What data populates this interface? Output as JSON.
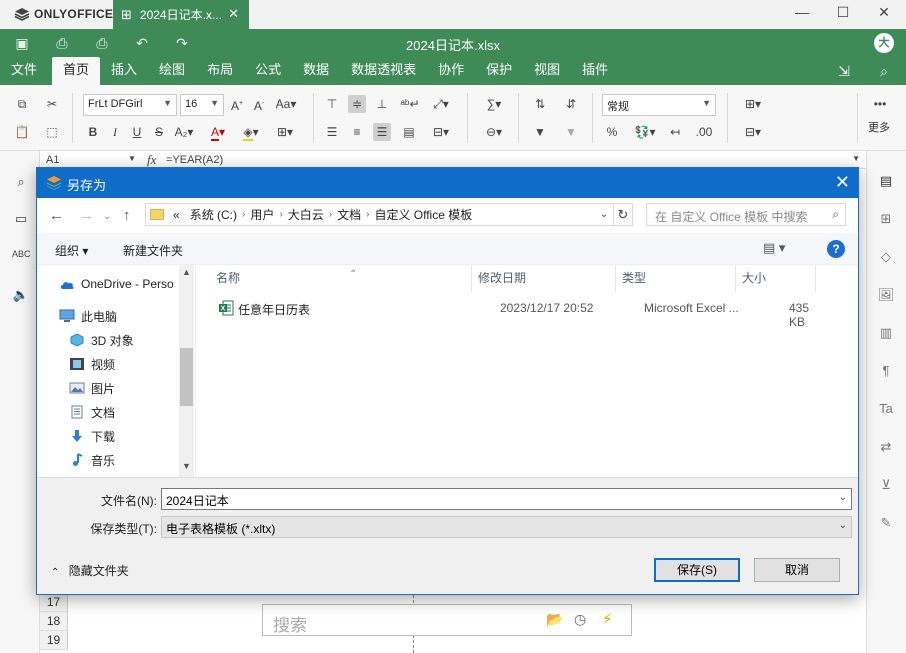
{
  "app": {
    "logo_text": "ONLYOFFICE",
    "tab_title": "2024日记本.x...",
    "file_title": "2024日记本.xlsx",
    "avatar_initial": "大",
    "accent_color": "#3f8b58"
  },
  "menu": {
    "tabs": [
      "文件",
      "首页",
      "插入",
      "绘图",
      "布局",
      "公式",
      "数据",
      "数据透视表",
      "协作",
      "保护",
      "视图",
      "插件"
    ],
    "active_tab": "首页"
  },
  "ribbon": {
    "font_name": "FrLt DFGirl",
    "font_size": "16",
    "number_format": "常规",
    "more_label": "更多"
  },
  "formula_bar": {
    "cell_ref": "A1",
    "fx_label": "fx",
    "formula": "=YEAR(A2)"
  },
  "sheet": {
    "row_headers": [
      "17",
      "18",
      "19"
    ],
    "search_placeholder": "搜索"
  },
  "dialog": {
    "title": "另存为",
    "accent_color": "#0f6cc9",
    "address": {
      "prefix": "«",
      "crumbs": [
        "系统 (C:)",
        "用户",
        "大白云",
        "文档",
        "自定义 Office 模板"
      ]
    },
    "search_placeholder": "在 自定义 Office 模板 中搜索",
    "toolbar": {
      "organize": "组织 ▾",
      "new_folder": "新建文件夹"
    },
    "nav_items": [
      {
        "label": "OneDrive - Perso",
        "icon": "cloud-icon"
      },
      {
        "label": "此电脑",
        "icon": "computer-icon"
      },
      {
        "label": "3D 对象",
        "icon": "cube-icon"
      },
      {
        "label": "视频",
        "icon": "film-icon"
      },
      {
        "label": "图片",
        "icon": "picture-icon"
      },
      {
        "label": "文档",
        "icon": "document-icon"
      },
      {
        "label": "下载",
        "icon": "download-arrow-icon"
      },
      {
        "label": "音乐",
        "icon": "music-note-icon"
      }
    ],
    "columns": [
      "名称",
      "修改日期",
      "类型",
      "大小"
    ],
    "files": [
      {
        "name": "任意年日历表",
        "modified": "2023/12/17 20:52",
        "type": "Microsoft Excel ...",
        "size": "435 KB"
      }
    ],
    "filename_label": "文件名(N):",
    "filename_value": "2024日记本",
    "filetype_label": "保存类型(T):",
    "filetype_value": "电子表格模板 (*.xltx)",
    "hide_folders": "隐藏文件夹",
    "save_button": "保存(S)",
    "cancel_button": "取消"
  }
}
